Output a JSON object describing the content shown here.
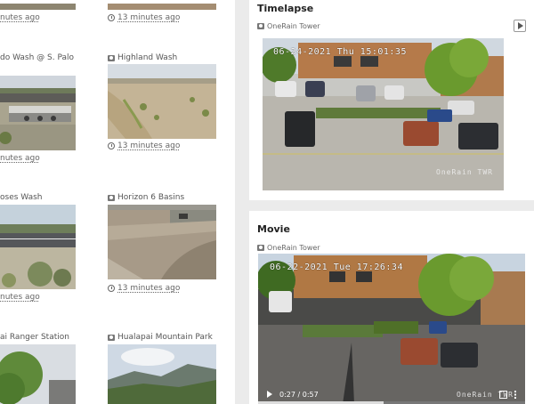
{
  "left_grid": {
    "cameras": [
      {
        "title": "",
        "time": "nutes ago"
      },
      {
        "title": "",
        "time": "13 minutes ago"
      },
      {
        "title": "do Wash @ S. Palo",
        "time": "nutes ago"
      },
      {
        "title": "Highland Wash",
        "time": "13 minutes ago"
      },
      {
        "title": "oses Wash",
        "time": "nutes ago"
      },
      {
        "title": "Horizon 6 Basins",
        "time": "13 minutes ago"
      },
      {
        "title": "ai Ranger Station",
        "time": ""
      },
      {
        "title": "Hualapai Mountain Park",
        "time": ""
      }
    ]
  },
  "timelapse": {
    "title": "Timelapse",
    "source": "OneRain Tower",
    "overlay": "06-24-2021 Thu 15:01:35",
    "watermark": "OneRain TWR"
  },
  "movie": {
    "title": "Movie",
    "source": "OneRain Tower",
    "overlay": "06-22-2021 Tue 17:26:34",
    "watermark": "OneRain TWR",
    "time_display": "0:27 / 0:57",
    "progress": 0.47
  },
  "colors": {
    "link": "#555555",
    "background": "#ebebeb",
    "card": "#ffffff"
  }
}
